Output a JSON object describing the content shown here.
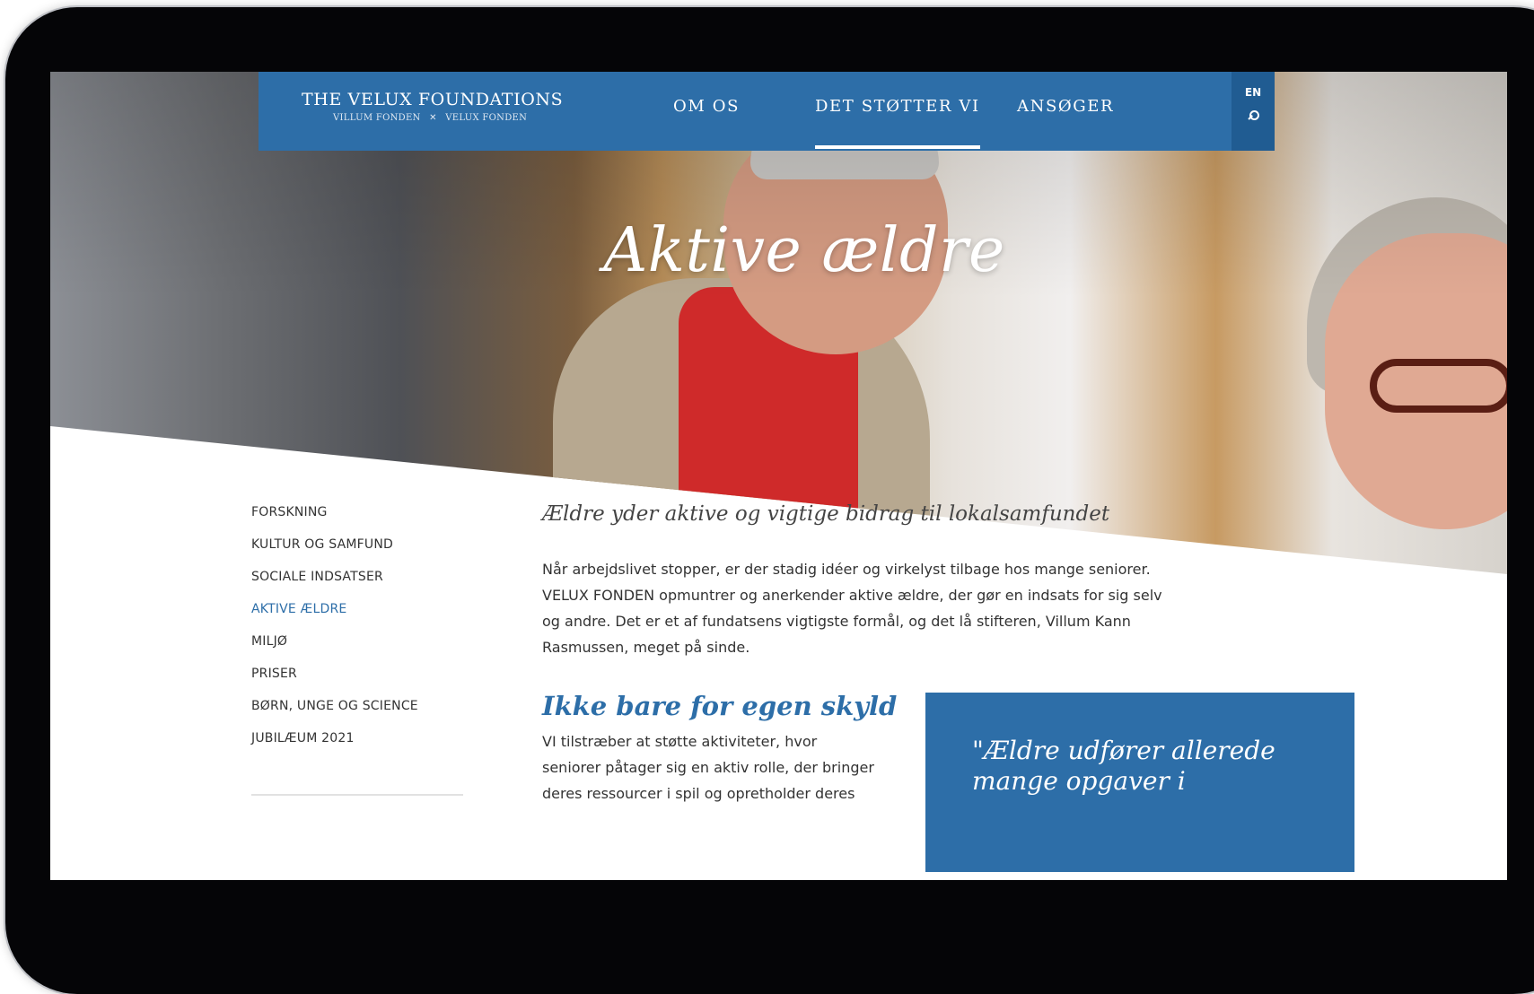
{
  "nav": {
    "logo_main": "THE VELUX FOUNDATIONS",
    "logo_sub_left": "VILLUM FONDEN",
    "logo_sub_sep": "✕",
    "logo_sub_right": "VELUX FONDEN",
    "items": [
      {
        "label": "OM OS"
      },
      {
        "label": "DET STØTTER VI"
      },
      {
        "label": "ANSØGER"
      }
    ],
    "active_item": "DET STØTTER VI",
    "lang": "EN"
  },
  "hero": {
    "title": "Aktive ældre"
  },
  "sidebar": {
    "items": [
      {
        "label": "FORSKNING"
      },
      {
        "label": "KULTUR OG SAMFUND"
      },
      {
        "label": "SOCIALE INDSATSER"
      },
      {
        "label": "AKTIVE ÆLDRE"
      },
      {
        "label": "MILJØ"
      },
      {
        "label": "PRISER"
      },
      {
        "label": "BØRN, UNGE OG SCIENCE"
      },
      {
        "label": "JUBILÆUM 2021"
      }
    ],
    "active_item": "AKTIVE ÆLDRE"
  },
  "main": {
    "lead": "Ældre yder aktive og vigtige bidrag til lokalsamfundet",
    "intro": "Når arbejdslivet stopper, er der stadig idéer og virkelyst tilbage hos mange seniorer. VELUX FONDEN opmuntrer og anerkender aktive ældre, der gør en indsats for sig selv og andre. Det er et af fundatsens vigtigste formål, og det lå stifteren, Villum Kann Rasmussen, meget på sinde.",
    "subhead": "Ikke bare for egen skyld",
    "col_text": "VI tilstræber at støtte aktiviteter, hvor seniorer påtager sig en aktiv rolle, der bringer deres ressourcer i spil og opretholder deres",
    "quote": "\"Ældre udfører allerede mange opgaver i"
  },
  "colors": {
    "brand_blue": "#2d6ea8",
    "active_text": "#2d6ea8"
  }
}
